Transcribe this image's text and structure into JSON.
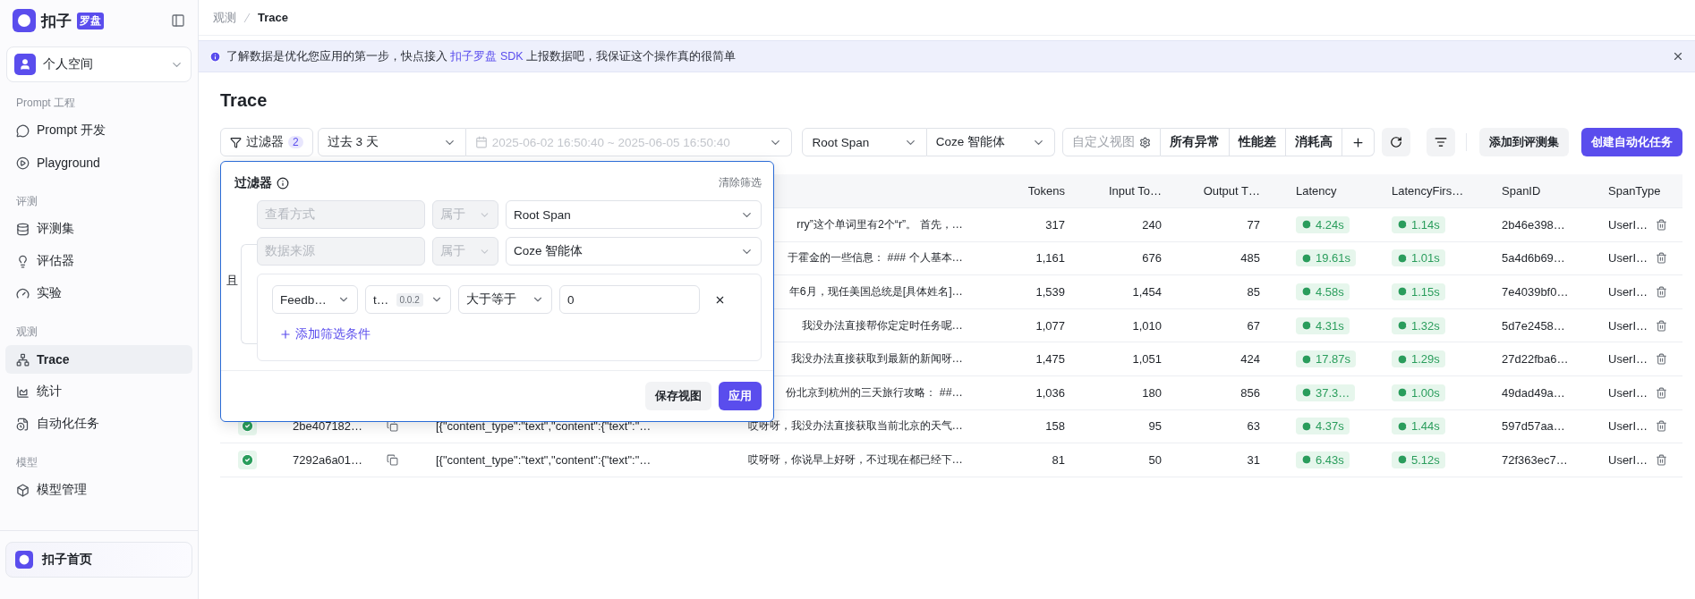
{
  "sidebar": {
    "logo": {
      "text": "扣子",
      "badge": "罗盘"
    },
    "workspace": "个人空间",
    "sections": [
      {
        "title": "Prompt 工程",
        "items": [
          {
            "label": "Prompt 开发",
            "selected": false
          },
          {
            "label": "Playground",
            "selected": false
          }
        ]
      },
      {
        "title": "评测",
        "items": [
          {
            "label": "评测集",
            "selected": false
          },
          {
            "label": "评估器",
            "selected": false
          },
          {
            "label": "实验",
            "selected": false
          }
        ]
      },
      {
        "title": "观测",
        "items": [
          {
            "label": "Trace",
            "selected": true
          },
          {
            "label": "统计",
            "selected": false
          },
          {
            "label": "自动化任务",
            "selected": false
          }
        ]
      },
      {
        "title": "模型",
        "items": [
          {
            "label": "模型管理",
            "selected": false
          }
        ]
      }
    ],
    "footer": "扣子首页"
  },
  "breadcrumb": [
    "观测",
    "Trace"
  ],
  "banner": {
    "text_before": "了解数据是优化您应用的第一步，快点接入 ",
    "link": "扣子罗盘 SDK",
    "text_after": " 上报数据吧，我保证这个操作真的很简单"
  },
  "title": "Trace",
  "toolbar": {
    "filter": {
      "label": "过滤器",
      "count": "2"
    },
    "time_range": "过去 3 天",
    "date_range": {
      "value": "2025-06-02 16:50:40 ~ 2025-06-05 16:50:40",
      "disabled": true
    },
    "span_select": "Root Span",
    "source_select": "Coze 智能体",
    "views": {
      "placeholder": "自定义视图",
      "items": [
        "所有异常",
        "性能差",
        "消耗高"
      ]
    },
    "buttons": [
      {
        "label": "添加到评测集",
        "kind": "secondary"
      },
      {
        "label": "创建自动化任务",
        "kind": "primary"
      }
    ]
  },
  "filter_popup": {
    "title": "过滤器",
    "clear": "清除筛选",
    "conjunction": "且",
    "fixed_rows": [
      {
        "field": "查看方式",
        "operator": "属于",
        "value": "Root Span",
        "disabled": true
      },
      {
        "field": "数据来源",
        "operator": "属于",
        "value": "Coze 智能体",
        "disabled": true
      }
    ],
    "custom_rows": [
      {
        "field": "Feedb…",
        "key": "t…",
        "version": "0.0.2",
        "operator": "大于等于",
        "value": "0"
      }
    ],
    "add_condition": "添加筛选条件",
    "buttons": [
      {
        "label": "保存视图",
        "kind": "secondary"
      },
      {
        "label": "应用",
        "kind": "primary"
      }
    ]
  },
  "table": {
    "columns": [
      "Tokens",
      "Input To…",
      "Output T…",
      "Latency",
      "LatencyFirs…",
      "SpanID",
      "SpanType"
    ],
    "rows": [
      {
        "output": "rry”这个单词里有2个“r”。 首先，…",
        "tokens": "317",
        "input_tokens": "240",
        "output_tokens": "77",
        "latency": "4.24s",
        "latency_first": "1.14s",
        "span_id": "2b46e398…",
        "span_type": "UserI…"
      },
      {
        "output": "于霍金的一些信息： ### 个人基本…",
        "tokens": "1,161",
        "input_tokens": "676",
        "output_tokens": "485",
        "latency": "19.61s",
        "latency_first": "1.01s",
        "span_id": "5a4d6b69…",
        "span_type": "UserI…"
      },
      {
        "output": "年6月，现任美国总统是[具体姓名]…",
        "tokens": "1,539",
        "input_tokens": "1,454",
        "output_tokens": "85",
        "latency": "4.58s",
        "latency_first": "1.15s",
        "span_id": "7e4039bf0…",
        "span_type": "UserI…"
      },
      {
        "output": "我没办法直接帮你定定时任务呢…",
        "tokens": "1,077",
        "input_tokens": "1,010",
        "output_tokens": "67",
        "latency": "4.31s",
        "latency_first": "1.32s",
        "span_id": "5d7e2458…",
        "span_type": "UserI…"
      },
      {
        "output": "我没办法直接获取到最新的新闻呀…",
        "tokens": "1,475",
        "input_tokens": "1,051",
        "output_tokens": "424",
        "latency": "17.87s",
        "latency_first": "1.29s",
        "span_id": "27d22fba6…",
        "span_type": "UserI…"
      },
      {
        "output": "份北京到杭州的三天旅行攻略： ##…",
        "tokens": "1,036",
        "input_tokens": "180",
        "output_tokens": "856",
        "latency": "37.3…",
        "latency_first": "1.00s",
        "span_id": "49dad49a…",
        "span_type": "UserI…"
      },
      {
        "success": true,
        "trace_id": "2be407182…",
        "input": "[{\"content_type\":\"text\",\"content\":{\"text\":\"…",
        "output": "哎呀呀，我没办法直接获取当前北京的天气…",
        "tokens": "158",
        "input_tokens": "95",
        "output_tokens": "63",
        "latency": "4.37s",
        "latency_first": "1.44s",
        "span_id": "597d57aa…",
        "span_type": "UserI…"
      },
      {
        "success": true,
        "trace_id": "7292a6a01…",
        "input": "[{\"content_type\":\"text\",\"content\":{\"text\":\"…",
        "output": "哎呀呀，你说早上好呀，不过现在都已经下…",
        "tokens": "81",
        "input_tokens": "50",
        "output_tokens": "31",
        "latency": "6.43s",
        "latency_first": "5.12s",
        "span_id": "72f363ec7…",
        "span_type": "UserI…"
      }
    ]
  }
}
